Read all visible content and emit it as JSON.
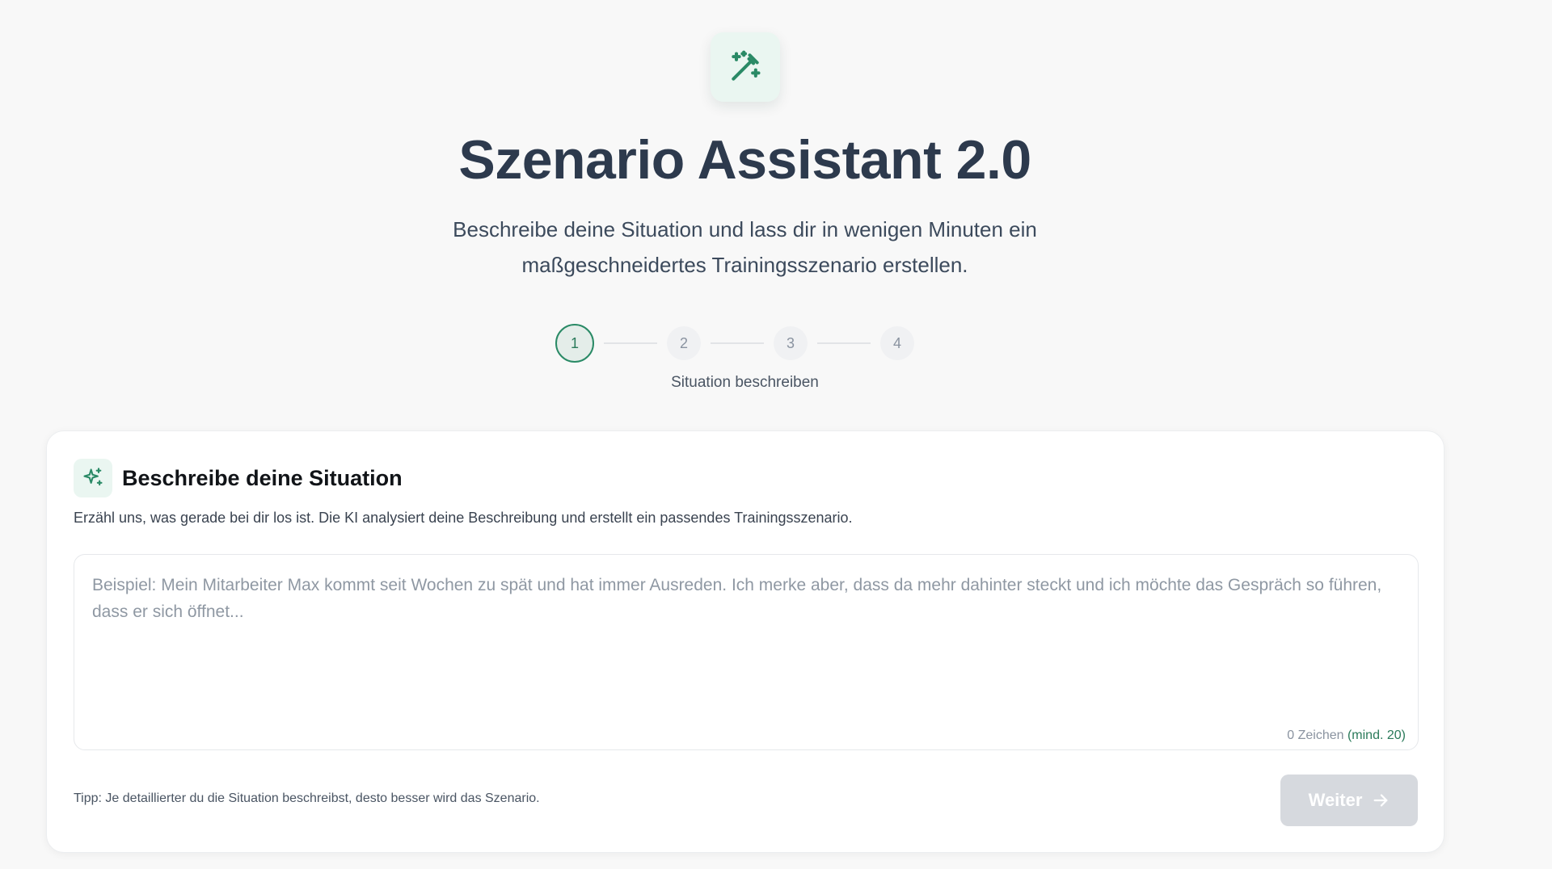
{
  "header": {
    "title": "Szenario Assistant 2.0",
    "subtitle_line1": "Beschreibe deine Situation und lass dir in wenigen Minuten ein",
    "subtitle_line2": "maßgeschneidertes Trainingsszenario erstellen.",
    "icon": "magic-wand-icon"
  },
  "stepper": {
    "steps": [
      "1",
      "2",
      "3",
      "4"
    ],
    "active_step": 1,
    "active_label": "Situation beschreiben"
  },
  "card": {
    "icon": "sparkles-icon",
    "title": "Beschreibe deine Situation",
    "description": "Erzähl uns, was gerade bei dir los ist. Die KI analysiert deine Beschreibung und erstellt ein passendes Trainingsszenario.",
    "textarea": {
      "value": "",
      "placeholder": "Beispiel: Mein Mitarbeiter Max kommt seit Wochen zu spät und hat immer Ausreden. Ich merke aber, dass da mehr dahinter steckt und ich möchte das Gespräch so führen, dass er sich öffnet..."
    },
    "char_count": "0 Zeichen",
    "char_min": "(mind. 20)",
    "tip": "Tipp: Je detaillierter du die Situation beschreibst, desto besser wird das Szenario.",
    "next_label": "Weiter"
  },
  "colors": {
    "accent": "#2a8a66",
    "accent_light": "#eaf6f1",
    "title": "#2d3a4d",
    "button_disabled": "#d6d9de"
  }
}
